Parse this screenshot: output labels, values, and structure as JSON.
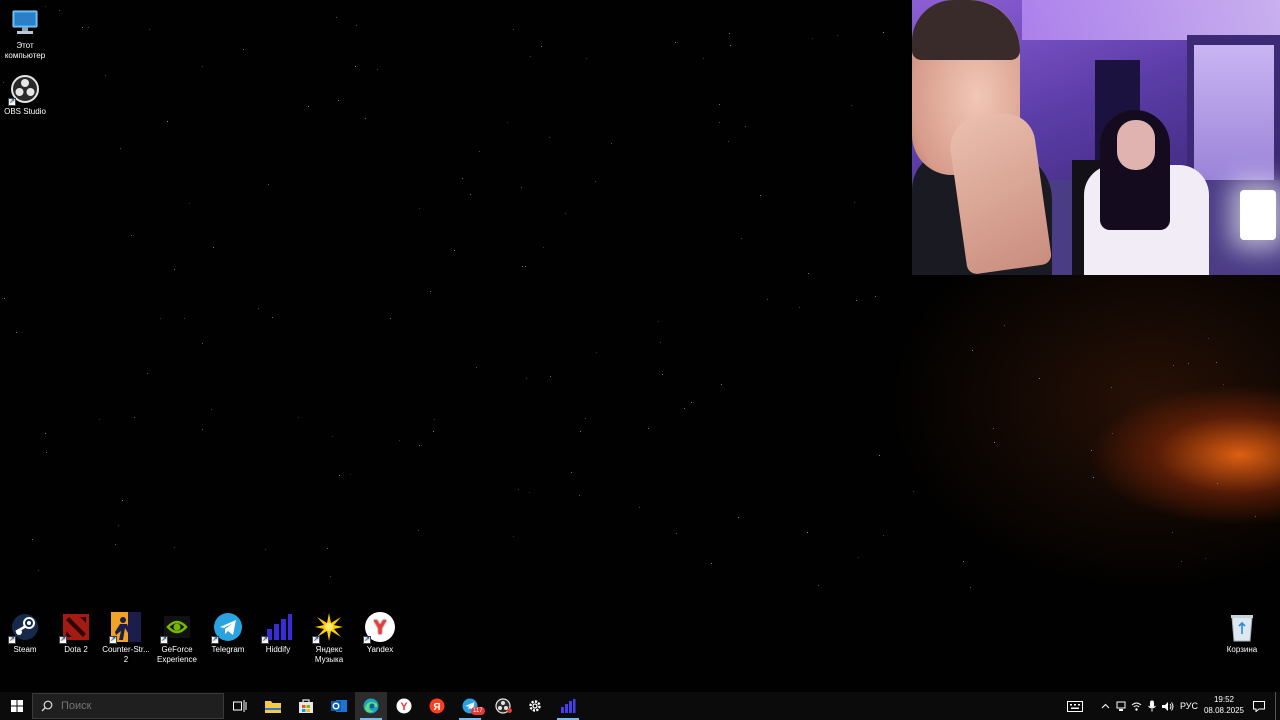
{
  "desktop": {
    "top_icons": [
      {
        "name": "this-pc",
        "label": "Этот компьютер",
        "icon": "computer-icon"
      },
      {
        "name": "obs-studio",
        "label": "OBS Studio",
        "icon": "obs-icon"
      }
    ],
    "bottom_icons": [
      {
        "name": "steam",
        "label": "Steam",
        "icon": "steam-icon"
      },
      {
        "name": "dota2",
        "label": "Dota 2",
        "icon": "dota2-icon"
      },
      {
        "name": "counter-strike-2",
        "label": "Counter-Str... 2",
        "icon": "counter-strike-icon"
      },
      {
        "name": "geforce-experience",
        "label": "GeForce Experience",
        "icon": "nvidia-icon"
      },
      {
        "name": "telegram",
        "label": "Telegram",
        "icon": "telegram-icon"
      },
      {
        "name": "hiddify",
        "label": "Hiddify",
        "icon": "hiddify-icon"
      },
      {
        "name": "yandex-music",
        "label": "Яндекс Музыка",
        "icon": "yandex-music-icon"
      },
      {
        "name": "yandex",
        "label": "Yandex",
        "icon": "yandex-browser-icon"
      }
    ],
    "recycle_bin": {
      "label": "Корзина",
      "icon": "recycle-bin-icon"
    }
  },
  "taskbar": {
    "search_placeholder": "Поиск",
    "apps": [
      {
        "name": "task-view",
        "icon": "task-view-icon"
      },
      {
        "name": "file-explorer",
        "icon": "folder-icon"
      },
      {
        "name": "microsoft-store",
        "icon": "store-icon"
      },
      {
        "name": "outlook",
        "icon": "outlook-icon"
      },
      {
        "name": "edge",
        "icon": "edge-icon",
        "active": true
      },
      {
        "name": "yandex-browser",
        "icon": "yandex-browser-icon"
      },
      {
        "name": "yandex",
        "icon": "yandex-icon"
      },
      {
        "name": "telegram",
        "icon": "telegram-icon",
        "badge": "117"
      },
      {
        "name": "obs-studio",
        "icon": "obs-icon"
      },
      {
        "name": "settings",
        "icon": "gear-icon"
      },
      {
        "name": "hiddify",
        "icon": "hiddify-icon"
      }
    ],
    "tray": {
      "language": "РУС",
      "time": "19:52",
      "date": "08.08.2025"
    }
  },
  "colors": {
    "taskbar_bg": "#0b0b0b",
    "accent": "#76b9ed",
    "glow": "#ff6e14"
  }
}
